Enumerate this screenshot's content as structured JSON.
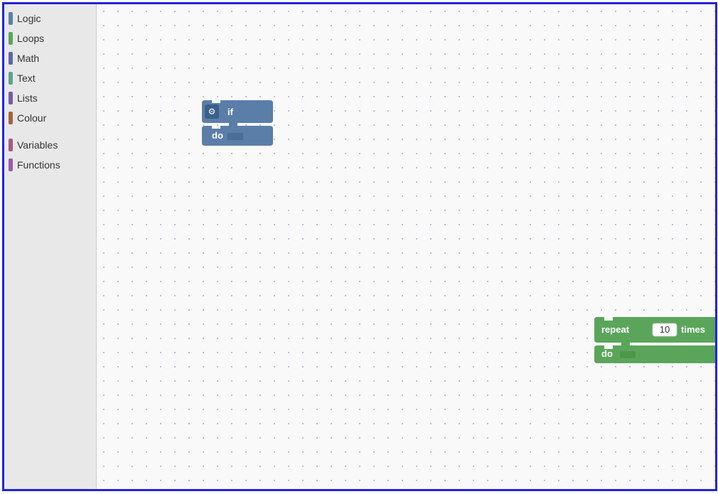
{
  "sidebar": {
    "items": [
      {
        "label": "Logic",
        "color": "#5b80a5"
      },
      {
        "label": "Loops",
        "color": "#5ba55b"
      },
      {
        "label": "Math",
        "color": "#5b67a5"
      },
      {
        "label": "Text",
        "color": "#5ba58a"
      },
      {
        "label": "Lists",
        "color": "#745ba5"
      },
      {
        "label": "Colour",
        "color": "#a5623d"
      }
    ],
    "divider": true,
    "items2": [
      {
        "label": "Variables",
        "color": "#a55b80"
      },
      {
        "label": "Functions",
        "color": "#9a5ba5"
      }
    ]
  },
  "if_block": {
    "gear_icon": "⚙",
    "if_label": "if",
    "do_label": "do"
  },
  "repeat_block": {
    "repeat_label": "repeat",
    "number": "10",
    "times_label": "times",
    "do_label": "do"
  }
}
